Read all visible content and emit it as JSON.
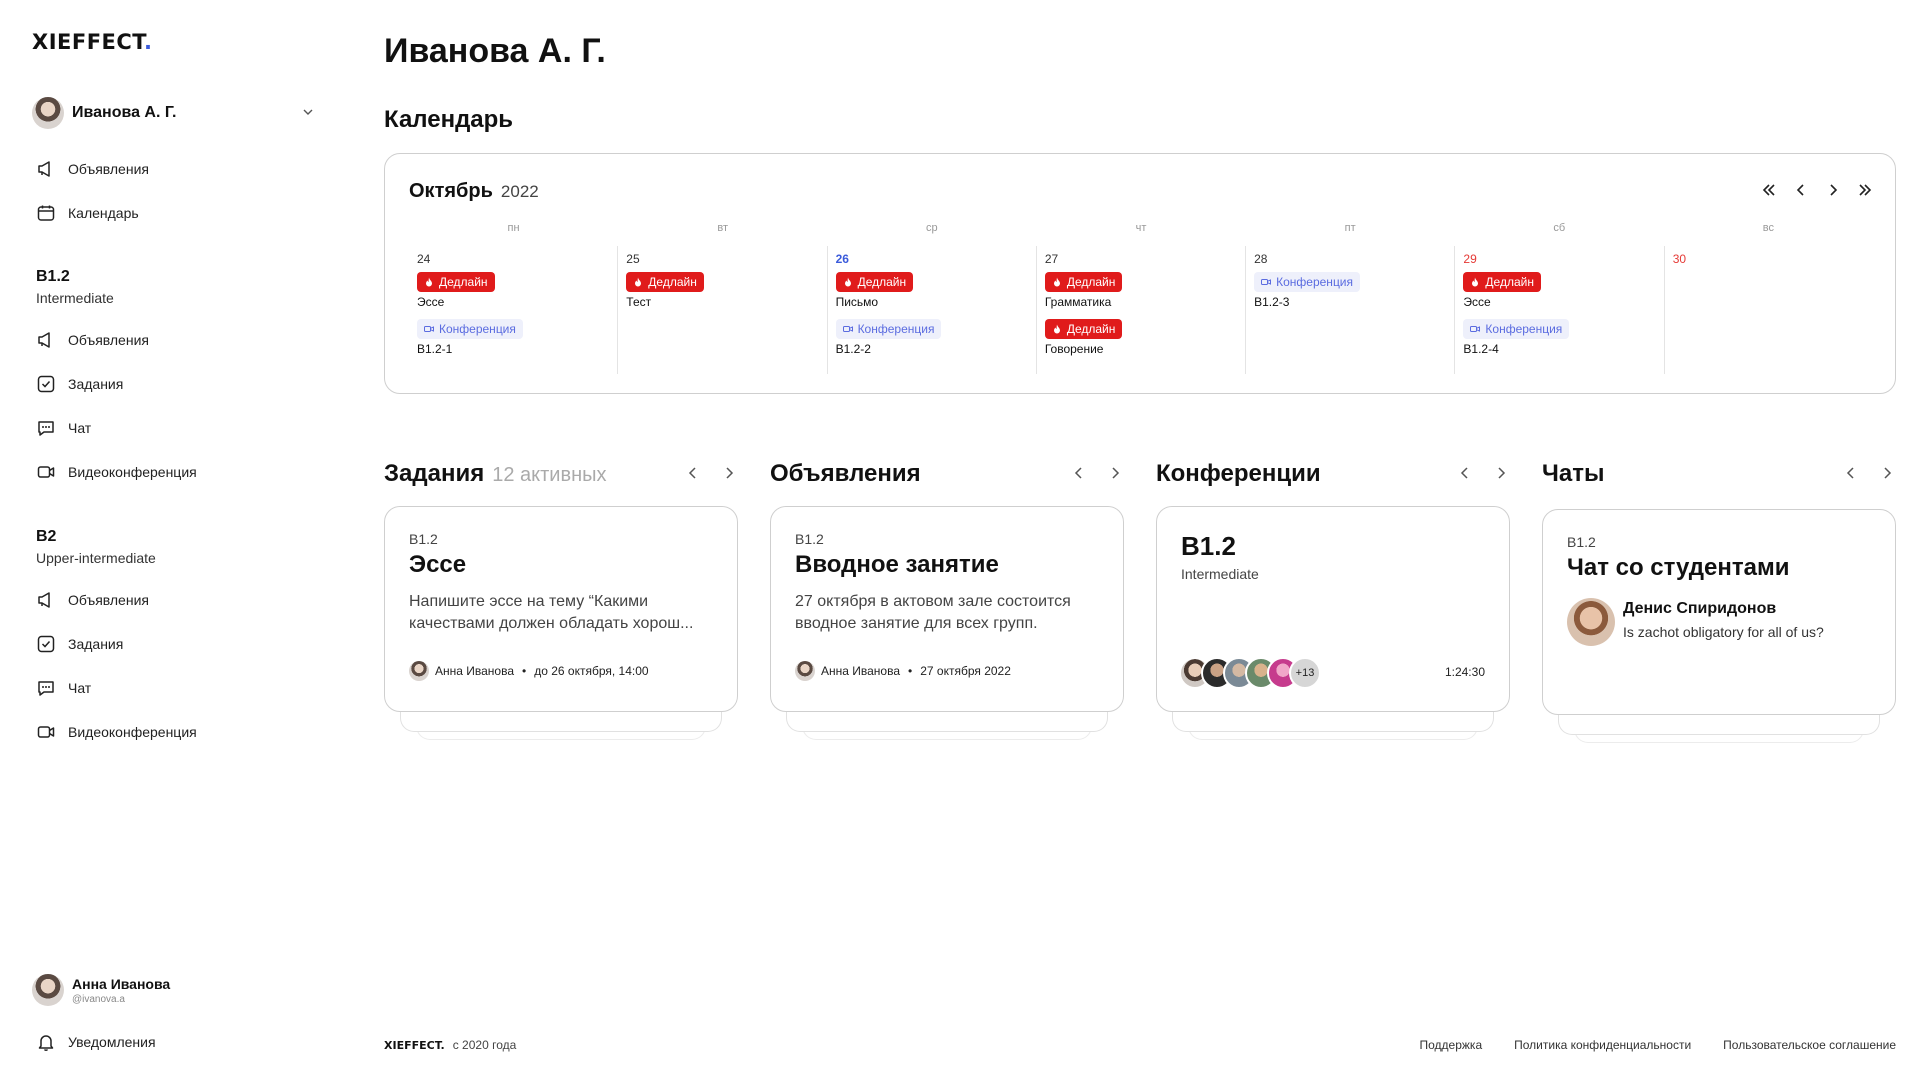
{
  "brand": {
    "logo": "XIEFFECT",
    "logo_dot": ".",
    "accent_color": "#3b5bdb"
  },
  "user": {
    "name": "Иванова А. Г."
  },
  "sidebar": {
    "top_items": [
      {
        "label": "Объявления",
        "icon": "megaphone-icon"
      },
      {
        "label": "Календарь",
        "icon": "calendar-icon"
      }
    ],
    "groups": [
      {
        "title": "B1.2",
        "subtitle": "Intermediate",
        "items": [
          {
            "label": "Объявления",
            "icon": "megaphone-icon"
          },
          {
            "label": "Задания",
            "icon": "task-check-icon"
          },
          {
            "label": "Чат",
            "icon": "chat-icon"
          },
          {
            "label": "Видеоконференция",
            "icon": "video-icon"
          }
        ]
      },
      {
        "title": "B2",
        "subtitle": "Upper-intermediate",
        "items": [
          {
            "label": "Объявления",
            "icon": "megaphone-icon"
          },
          {
            "label": "Задания",
            "icon": "task-check-icon"
          },
          {
            "label": "Чат",
            "icon": "chat-icon"
          },
          {
            "label": "Видеоконференция",
            "icon": "video-icon"
          }
        ]
      }
    ],
    "bottom_profile": {
      "name": "Анна Иванова",
      "handle": "@ivanova.a"
    },
    "notifications_label": "Уведомления"
  },
  "page": {
    "title": "Иванова А. Г.",
    "calendar_section": "Календарь"
  },
  "calendar": {
    "month": "Октябрь",
    "year": "2022",
    "weekdays": [
      "пн",
      "вт",
      "ср",
      "чт",
      "пт",
      "сб",
      "вс"
    ],
    "days": [
      {
        "num": "24",
        "state": "normal",
        "events": [
          {
            "type": "deadline",
            "badge": "Дедлайн",
            "label": "Эссе"
          },
          {
            "type": "conf",
            "badge": "Конференция",
            "label": "B1.2-1"
          }
        ]
      },
      {
        "num": "25",
        "state": "normal",
        "events": [
          {
            "type": "deadline",
            "badge": "Дедлайн",
            "label": "Тест"
          }
        ]
      },
      {
        "num": "26",
        "state": "today",
        "events": [
          {
            "type": "deadline",
            "badge": "Дедлайн",
            "label": "Письмо"
          },
          {
            "type": "conf",
            "badge": "Конференция",
            "label": "B1.2-2"
          }
        ]
      },
      {
        "num": "27",
        "state": "normal",
        "events": [
          {
            "type": "deadline",
            "badge": "Дедлайн",
            "label": "Грамматика"
          },
          {
            "type": "deadline",
            "badge": "Дедлайн",
            "label": "Говорение"
          }
        ]
      },
      {
        "num": "28",
        "state": "normal",
        "events": [
          {
            "type": "conf",
            "badge": "Конференция",
            "label": "B1.2-3"
          }
        ]
      },
      {
        "num": "29",
        "state": "weekend",
        "events": [
          {
            "type": "deadline",
            "badge": "Дедлайн",
            "label": "Эссе"
          },
          {
            "type": "conf",
            "badge": "Конференция",
            "label": "B1.2-4"
          }
        ]
      },
      {
        "num": "30",
        "state": "weekend",
        "events": []
      }
    ]
  },
  "widgets": {
    "tasks": {
      "title": "Задания",
      "count": "12 активных",
      "card": {
        "tag": "B1.2",
        "title": "Эссе",
        "desc": "Напишите эссе на тему “Какими качествами должен обладать хорош...",
        "author": "Анна Иванова",
        "sep": "•",
        "when": "до 26 октября, 14:00"
      }
    },
    "announcements": {
      "title": "Объявления",
      "card": {
        "tag": "B1.2",
        "title": "Вводное занятие",
        "desc": "27 октября в актовом зале состоится вводное занятие для всех групп.",
        "author": "Анна Иванова",
        "sep": "•",
        "when": "27 октября 2022"
      }
    },
    "conferences": {
      "title": "Конференции",
      "card": {
        "title": "B1.2",
        "subtitle": "Intermediate",
        "more": "+13",
        "timer": "1:24:30"
      }
    },
    "chats": {
      "title": "Чаты",
      "card": {
        "tag": "B1.2",
        "title": "Чат со студентами",
        "sender": "Денис Спиридонов",
        "message": "Is zachot obligatory for all of us?"
      }
    }
  },
  "footer": {
    "logo": "XIEFFECT.",
    "since": "с 2020 года",
    "links": [
      "Поддержка",
      "Политика конфиденциальности",
      "Пользовательское соглашение"
    ]
  },
  "colors": {
    "deadline": "#e01b1b",
    "conference_bg": "#eef0fb",
    "conference_fg": "#5b6ce0",
    "weekend": "#e53935"
  }
}
